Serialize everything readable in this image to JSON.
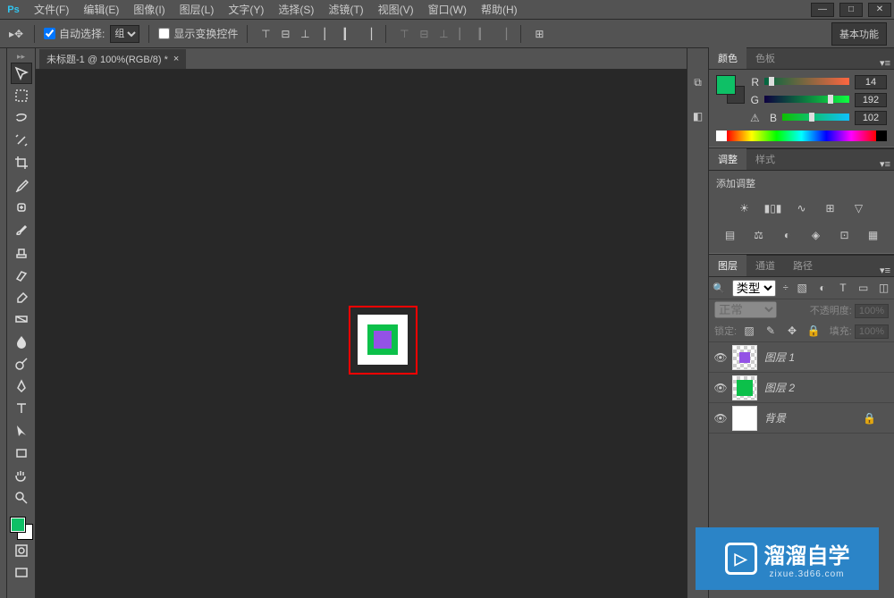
{
  "app": {
    "logo": "Ps"
  },
  "menu": {
    "file": "文件(F)",
    "edit": "编辑(E)",
    "image": "图像(I)",
    "layer": "图层(L)",
    "type": "文字(Y)",
    "select": "选择(S)",
    "filter": "滤镜(T)",
    "view": "视图(V)",
    "window": "窗口(W)",
    "help": "帮助(H)"
  },
  "options": {
    "auto_select": "自动选择:",
    "group": "组",
    "show_transform": "显示变换控件",
    "workspace": "基本功能"
  },
  "document": {
    "tab": "未标题-1 @ 100%(RGB/8) *"
  },
  "color_panel": {
    "tab_color": "颜色",
    "tab_swatches": "色板",
    "r_label": "R",
    "r_val": "14",
    "g_label": "G",
    "g_val": "192",
    "b_label": "B",
    "b_val": "102",
    "preview": "#0ec066"
  },
  "adjust_panel": {
    "tab_adjust": "调整",
    "tab_styles": "样式",
    "title": "添加调整"
  },
  "layers_panel": {
    "tab_layers": "图层",
    "tab_channels": "通道",
    "tab_paths": "路径",
    "kind_label": "类型",
    "blend_mode": "正常",
    "opacity_label": "不透明度:",
    "opacity_val": "100%",
    "lock_label": "锁定:",
    "fill_label": "填充:",
    "fill_val": "100%",
    "layers": [
      {
        "name": "图层 1",
        "color": "#9352e5"
      },
      {
        "name": "图层 2",
        "color": "#0cc04a"
      },
      {
        "name": "背景",
        "color": "#ffffff"
      }
    ]
  },
  "colors": {
    "fg": "#0ec066",
    "bg": "#ffffff"
  },
  "watermark": {
    "main": "溜溜自学",
    "sub": "zixue.3d66.com"
  }
}
